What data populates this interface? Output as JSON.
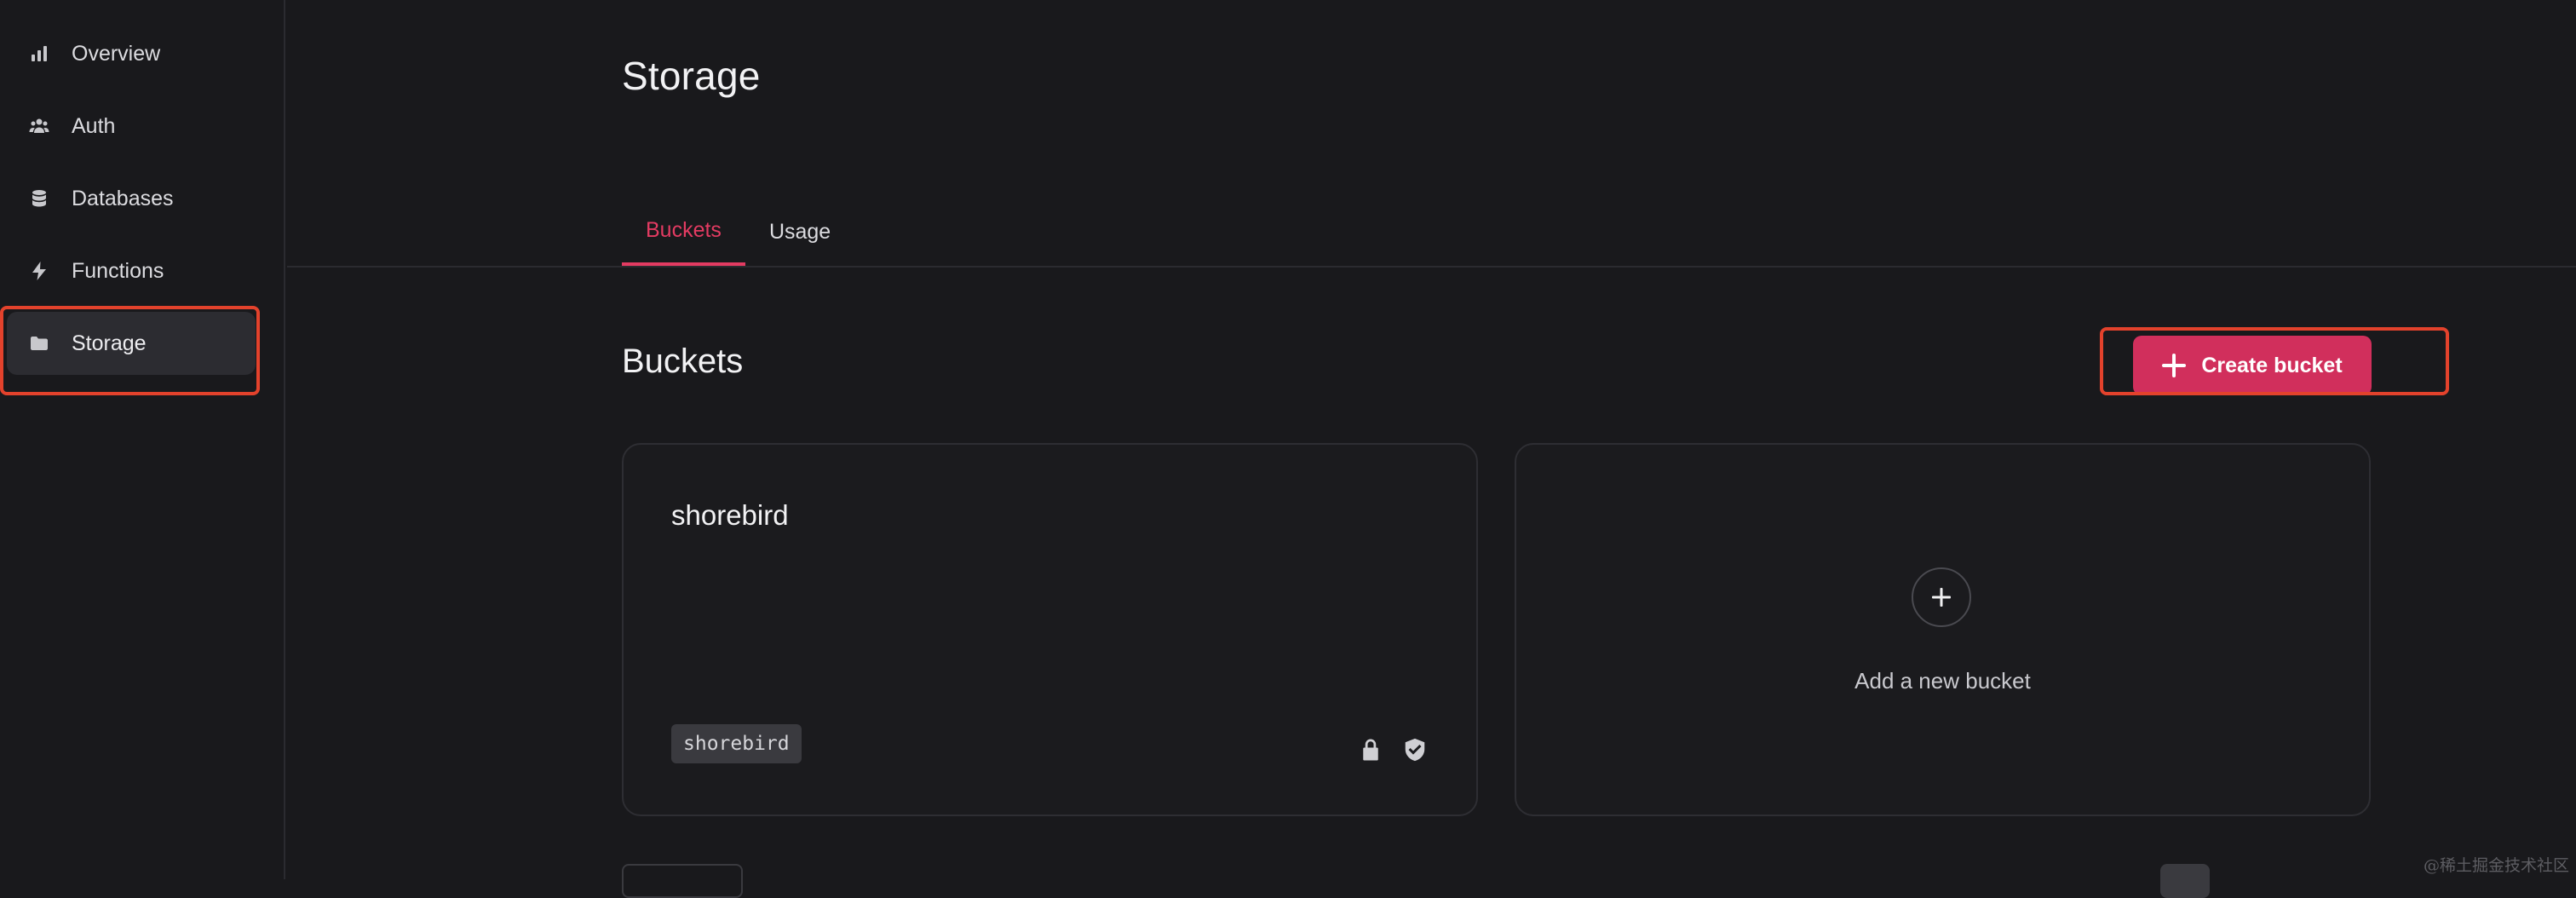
{
  "sidebar": {
    "items": [
      {
        "label": "Overview",
        "icon": "bar-chart-icon"
      },
      {
        "label": "Auth",
        "icon": "users-icon"
      },
      {
        "label": "Databases",
        "icon": "database-icon"
      },
      {
        "label": "Functions",
        "icon": "lightning-icon"
      },
      {
        "label": "Storage",
        "icon": "folder-icon",
        "active": true
      }
    ]
  },
  "header": {
    "title": "Storage"
  },
  "tabs": [
    {
      "label": "Buckets",
      "active": true
    },
    {
      "label": "Usage",
      "active": false
    }
  ],
  "buckets_section": {
    "title": "Buckets",
    "create_button": "Create bucket"
  },
  "buckets": [
    {
      "name": "shorebird",
      "id": "shorebird",
      "icons": [
        "lock-icon",
        "shield-check-icon"
      ]
    }
  ],
  "add_card": {
    "label": "Add a new bucket"
  },
  "watermark": "@稀土掘金技术社区",
  "colors": {
    "accent": "#e33b62",
    "button": "#d12f5c",
    "highlight": "#e3422c",
    "background": "#19191c"
  }
}
